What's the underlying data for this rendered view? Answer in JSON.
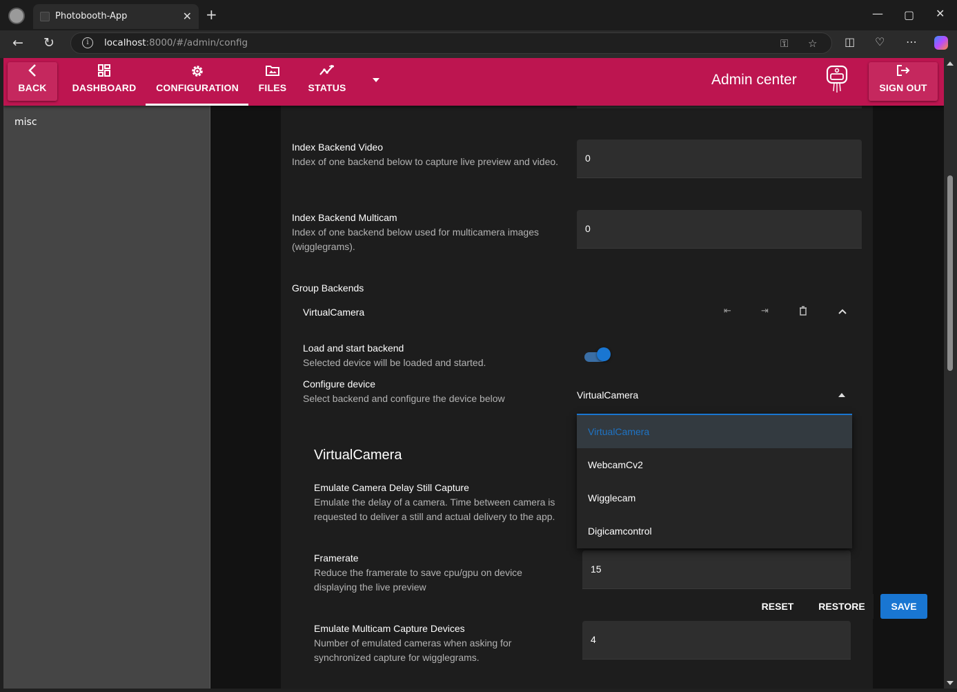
{
  "browser": {
    "tab_title": "Photobooth-App",
    "url_host": "localhost",
    "url_rest": ":8000/#/admin/config"
  },
  "header": {
    "back_label": "BACK",
    "nav": [
      {
        "label": "DASHBOARD",
        "icon": "dashboard-icon"
      },
      {
        "label": "CONFIGURATION",
        "icon": "gear-icon"
      },
      {
        "label": "FILES",
        "icon": "folder-image-icon"
      },
      {
        "label": "STATUS",
        "icon": "chart-line-icon"
      }
    ],
    "title": "Admin center",
    "signout_label": "SIGN OUT",
    "accent": "#bd1550"
  },
  "sidebar": {
    "items": [
      "misc"
    ]
  },
  "fields": {
    "index_video": {
      "label": "Index Backend Video",
      "desc": "Index of one backend below to capture live preview and video.",
      "value": "0"
    },
    "index_multicam": {
      "label": "Index Backend Multicam",
      "desc": "Index of one backend below used for multicamera images (wigglegrams).",
      "value": "0"
    },
    "group_backends": {
      "label": "Group Backends"
    },
    "backend_item": {
      "title": "VirtualCamera"
    },
    "load_start": {
      "label": "Load and start backend",
      "desc": "Selected device will be loaded and started.",
      "enabled": true
    },
    "configure_device": {
      "label": "Configure device",
      "desc": "Select backend and configure the device below",
      "value": "VirtualCamera",
      "options": [
        "VirtualCamera",
        "WebcamCv2",
        "Wigglecam",
        "Digicamcontrol"
      ]
    },
    "section_title": "VirtualCamera",
    "emulate_delay": {
      "label": "Emulate Camera Delay Still Capture",
      "desc": "Emulate the delay of a camera. Time between camera is requested to deliver a still and actual delivery to the app."
    },
    "framerate": {
      "label": "Framerate",
      "desc": "Reduce the framerate to save cpu/gpu on device displaying the live preview",
      "value": "15"
    },
    "emulate_multicam": {
      "label": "Emulate Multicam Capture Devices",
      "desc": "Number of emulated cameras when asking for synchronized capture for wigglegrams.",
      "value": "4"
    }
  },
  "footer": {
    "reset": "RESET",
    "restore": "RESTORE",
    "save": "SAVE",
    "save_color": "#1976d2"
  }
}
